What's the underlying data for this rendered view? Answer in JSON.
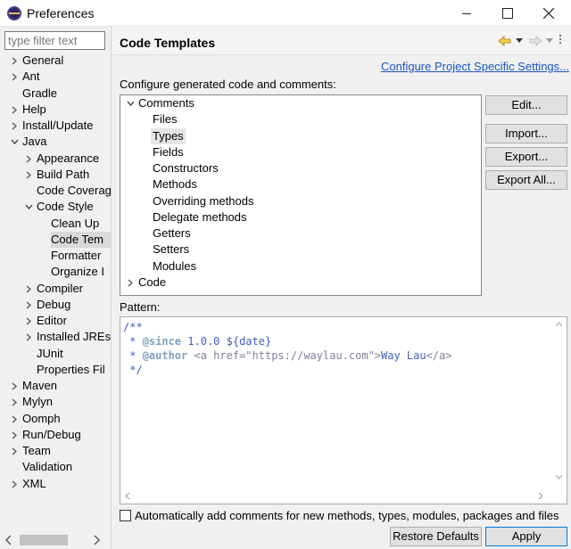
{
  "window": {
    "title": "Preferences"
  },
  "filter": {
    "placeholder": "type filter text"
  },
  "nav": [
    {
      "label": "General",
      "level": 0,
      "state": "collapsed"
    },
    {
      "label": "Ant",
      "level": 0,
      "state": "collapsed"
    },
    {
      "label": "Gradle",
      "level": 0,
      "state": "leaf"
    },
    {
      "label": "Help",
      "level": 0,
      "state": "collapsed"
    },
    {
      "label": "Install/Update",
      "level": 0,
      "state": "collapsed"
    },
    {
      "label": "Java",
      "level": 0,
      "state": "expanded"
    },
    {
      "label": "Appearance",
      "level": 1,
      "state": "collapsed"
    },
    {
      "label": "Build Path",
      "level": 1,
      "state": "collapsed"
    },
    {
      "label": "Code Coverag",
      "level": 1,
      "state": "leaf"
    },
    {
      "label": "Code Style",
      "level": 1,
      "state": "expanded"
    },
    {
      "label": "Clean Up",
      "level": 2,
      "state": "leaf"
    },
    {
      "label": "Code Tem",
      "level": 2,
      "state": "leaf",
      "selected": true
    },
    {
      "label": "Formatter",
      "level": 2,
      "state": "leaf"
    },
    {
      "label": "Organize I",
      "level": 2,
      "state": "leaf"
    },
    {
      "label": "Compiler",
      "level": 1,
      "state": "collapsed"
    },
    {
      "label": "Debug",
      "level": 1,
      "state": "collapsed"
    },
    {
      "label": "Editor",
      "level": 1,
      "state": "collapsed"
    },
    {
      "label": "Installed JREs",
      "level": 1,
      "state": "collapsed"
    },
    {
      "label": "JUnit",
      "level": 1,
      "state": "leaf"
    },
    {
      "label": "Properties Fil",
      "level": 1,
      "state": "leaf"
    },
    {
      "label": "Maven",
      "level": 0,
      "state": "collapsed"
    },
    {
      "label": "Mylyn",
      "level": 0,
      "state": "collapsed"
    },
    {
      "label": "Oomph",
      "level": 0,
      "state": "collapsed"
    },
    {
      "label": "Run/Debug",
      "level": 0,
      "state": "collapsed"
    },
    {
      "label": "Team",
      "level": 0,
      "state": "collapsed"
    },
    {
      "label": "Validation",
      "level": 0,
      "state": "leaf"
    },
    {
      "label": "XML",
      "level": 0,
      "state": "collapsed"
    }
  ],
  "page": {
    "title": "Code Templates",
    "configure_link": "Configure Project Specific Settings...",
    "description": "Configure generated code and comments:"
  },
  "templates": [
    {
      "label": "Comments",
      "level": 0,
      "state": "expanded"
    },
    {
      "label": "Files",
      "level": 1,
      "state": "leaf"
    },
    {
      "label": "Types",
      "level": 1,
      "state": "leaf",
      "selected": true
    },
    {
      "label": "Fields",
      "level": 1,
      "state": "leaf"
    },
    {
      "label": "Constructors",
      "level": 1,
      "state": "leaf"
    },
    {
      "label": "Methods",
      "level": 1,
      "state": "leaf"
    },
    {
      "label": "Overriding methods",
      "level": 1,
      "state": "leaf"
    },
    {
      "label": "Delegate methods",
      "level": 1,
      "state": "leaf"
    },
    {
      "label": "Getters",
      "level": 1,
      "state": "leaf"
    },
    {
      "label": "Setters",
      "level": 1,
      "state": "leaf"
    },
    {
      "label": "Modules",
      "level": 1,
      "state": "leaf"
    },
    {
      "label": "Code",
      "level": 0,
      "state": "collapsed"
    }
  ],
  "buttons": {
    "edit": "Edit...",
    "import": "Import...",
    "export": "Export...",
    "export_all": "Export All..."
  },
  "pattern": {
    "label": "Pattern:",
    "lines": [
      [
        {
          "t": "/**",
          "c": ""
        }
      ],
      [
        {
          "t": " * ",
          "c": ""
        },
        {
          "t": "@since",
          "c": "tag"
        },
        {
          "t": " 1.0.0 ${date}",
          "c": ""
        }
      ],
      [
        {
          "t": " * ",
          "c": ""
        },
        {
          "t": "@author",
          "c": "tag"
        },
        {
          "t": " ",
          "c": ""
        },
        {
          "t": "<a href=\"https://waylau.com\">",
          "c": "kw"
        },
        {
          "t": "Way Lau",
          "c": ""
        },
        {
          "t": "</a>",
          "c": "kw"
        }
      ],
      [
        {
          "t": " */",
          "c": ""
        }
      ]
    ]
  },
  "auto_comments": {
    "label": "Automatically add comments for new methods, types, modules, packages and files",
    "checked": false
  },
  "footer": {
    "restore": "Restore Defaults",
    "apply": "Apply"
  },
  "colors": {
    "link": "#1a55c0",
    "code_comment": "#3f5fbf",
    "code_tag": "#7f9fbf",
    "code_html": "#7f7f9f",
    "selection": "#d9d9d9"
  }
}
